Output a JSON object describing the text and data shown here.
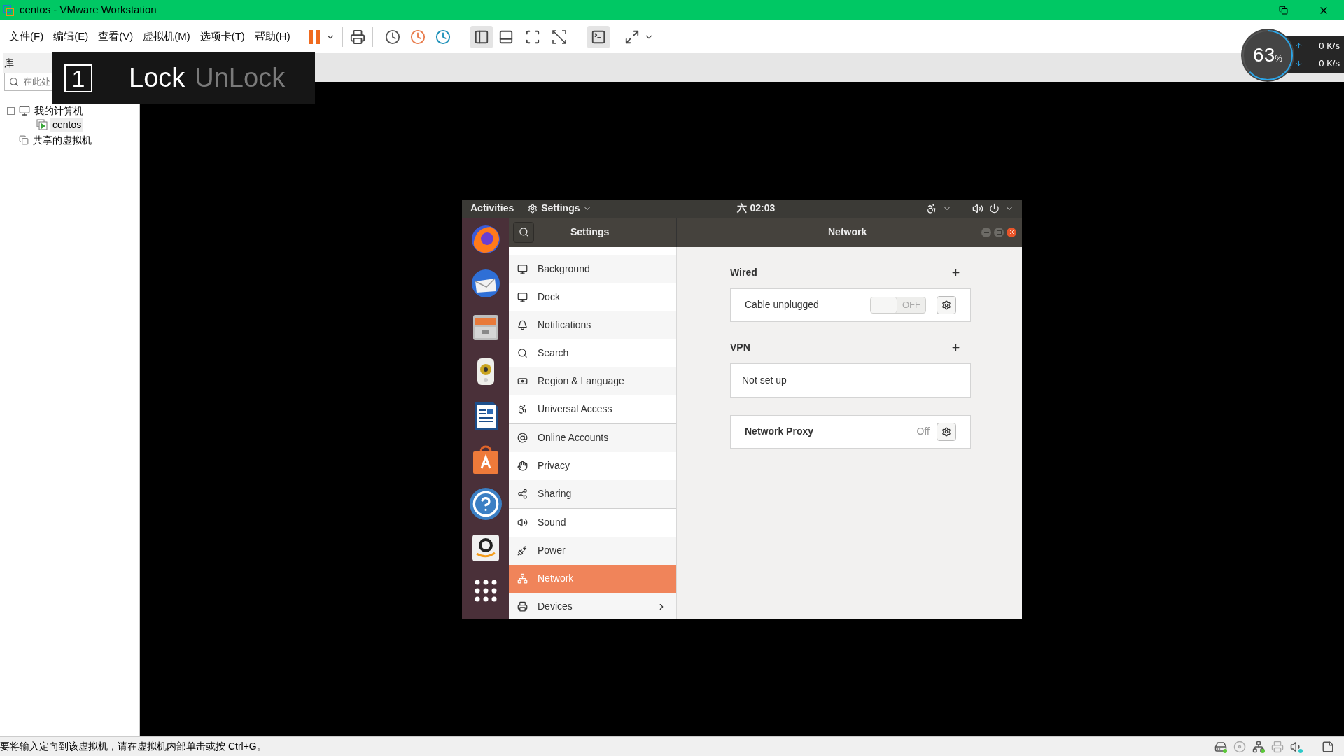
{
  "window": {
    "title": "centos - VMware Workstation"
  },
  "menu": [
    "文件(F)",
    "编辑(E)",
    "查看(V)",
    "虚拟机(M)",
    "选项卡(T)",
    "帮助(H)"
  ],
  "library": {
    "title": "库",
    "search_placeholder": "在此处",
    "tree": [
      {
        "label": "我的计算机",
        "expanded": true,
        "selected": false,
        "children": [
          {
            "label": "centos",
            "selected": true
          }
        ]
      },
      {
        "label": "共享的虚拟机",
        "selected": false
      }
    ]
  },
  "lock_overlay": {
    "number": "1",
    "lock": "Lock",
    "unlock": "UnLock"
  },
  "performance": {
    "percent": "63",
    "unit": "%",
    "upload": "0",
    "upload_unit": "K/s",
    "download": "0",
    "download_unit": "K/s"
  },
  "guest": {
    "top_bar": {
      "activities": "Activities",
      "app_menu": "Settings",
      "clock_day": "六",
      "clock_time": "02:03"
    },
    "settings": {
      "sidebar_title": "Settings",
      "page_title": "Network",
      "groups": [
        {
          "items": [
            {
              "label": "Background",
              "selected": false,
              "kind": "page"
            },
            {
              "label": "Dock",
              "selected": false,
              "kind": "page"
            },
            {
              "label": "Notifications",
              "selected": false,
              "kind": "page"
            },
            {
              "label": "Search",
              "selected": false,
              "kind": "page"
            },
            {
              "label": "Region & Language",
              "selected": false,
              "kind": "page"
            },
            {
              "label": "Universal Access",
              "selected": false,
              "kind": "page"
            }
          ]
        },
        {
          "items": [
            {
              "label": "Online Accounts",
              "selected": false,
              "kind": "page"
            },
            {
              "label": "Privacy",
              "selected": false,
              "kind": "page"
            },
            {
              "label": "Sharing",
              "selected": false,
              "kind": "page"
            }
          ]
        },
        {
          "items": [
            {
              "label": "Sound",
              "selected": false,
              "kind": "page"
            },
            {
              "label": "Power",
              "selected": false,
              "kind": "page"
            },
            {
              "label": "Network",
              "selected": true,
              "kind": "page"
            },
            {
              "label": "Devices",
              "selected": false,
              "kind": "submenu"
            }
          ]
        }
      ],
      "network": {
        "wired": {
          "title": "Wired",
          "devices": [
            {
              "label": "Cable unplugged",
              "on": false,
              "switch_text": "OFF"
            }
          ]
        },
        "vpn": {
          "title": "VPN",
          "empty": "Not set up"
        },
        "proxy": {
          "label": "Network Proxy",
          "value": "Off"
        }
      }
    }
  },
  "status_bar": {
    "message": "要将输入定向到该虚拟机，请在虚拟机内部单击或按 Ctrl+G。"
  }
}
